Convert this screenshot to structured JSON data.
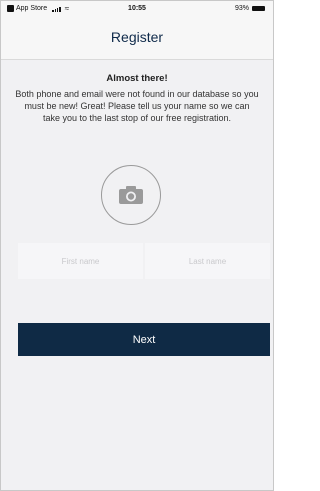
{
  "status_bar": {
    "carrier": "App Store",
    "time": "10:55",
    "battery": "93%"
  },
  "nav": {
    "title": "Register"
  },
  "main": {
    "heading": "Almost there!",
    "message": "Both phone and email were  not found in our database so you must be new! Great! Please tell us your name so we can take you to the last stop of our free registration.",
    "first_name": {
      "placeholder": "First name",
      "value": ""
    },
    "last_name": {
      "placeholder": "Last name",
      "value": ""
    },
    "next_label": "Next",
    "photo_icon": "camera-icon"
  },
  "colors": {
    "primary": "#0f2a45",
    "title": "#0f2a4a",
    "background": "#f1f1f3"
  }
}
